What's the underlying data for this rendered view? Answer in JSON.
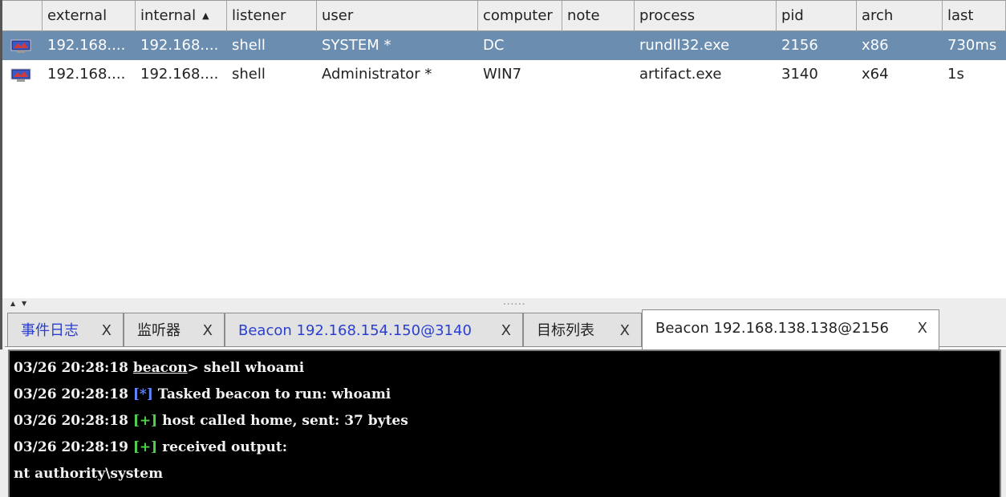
{
  "table": {
    "columns": [
      {
        "key": "external",
        "label": "external"
      },
      {
        "key": "internal",
        "label": "internal",
        "sort": "▲"
      },
      {
        "key": "listener",
        "label": "listener"
      },
      {
        "key": "user",
        "label": "user"
      },
      {
        "key": "computer",
        "label": "computer"
      },
      {
        "key": "note",
        "label": "note"
      },
      {
        "key": "process",
        "label": "process"
      },
      {
        "key": "pid",
        "label": "pid"
      },
      {
        "key": "arch",
        "label": "arch"
      },
      {
        "key": "last",
        "label": "last"
      }
    ],
    "rows": [
      {
        "external": "192.168....",
        "internal": "192.168....",
        "listener": "shell",
        "user": "SYSTEM *",
        "computer": "DC",
        "note": "",
        "process": "rundll32.exe",
        "pid": "2156",
        "arch": "x86",
        "last": "730ms",
        "icon": "beacon-session-icon",
        "selected": true
      },
      {
        "external": "192.168....",
        "internal": "192.168....",
        "listener": "shell",
        "user": "Administrator *",
        "computer": "WIN7",
        "note": "",
        "process": "artifact.exe",
        "pid": "3140",
        "arch": "x64",
        "last": "1s",
        "icon": "beacon-session-icon",
        "selected": false
      }
    ]
  },
  "tabs": [
    {
      "label": "事件日志",
      "close": "X",
      "style": "blue",
      "active": false
    },
    {
      "label": "监听器",
      "close": "X",
      "style": "normal",
      "active": false
    },
    {
      "label": "Beacon 192.168.154.150@3140",
      "close": "X",
      "style": "blue",
      "active": false
    },
    {
      "label": "目标列表",
      "close": "X",
      "style": "normal",
      "active": false
    },
    {
      "label": "Beacon 192.168.138.138@2156",
      "close": "X",
      "style": "normal",
      "active": true
    }
  ],
  "console": {
    "lines": [
      {
        "ts": "03/26 20:28:18",
        "prompt": "beacon",
        "prompt_suffix": ">",
        "text": " shell whoami"
      },
      {
        "ts": "03/26 20:28:18",
        "tag": "[*]",
        "tag_color": "blue",
        "text": " Tasked beacon to run: whoami"
      },
      {
        "ts": "03/26 20:28:18",
        "tag": "[+]",
        "tag_color": "green",
        "text": " host called home, sent: 37 bytes"
      },
      {
        "ts": "03/26 20:28:19",
        "tag": "[+]",
        "tag_color": "green",
        "text": " received output:"
      },
      {
        "ts": "",
        "text": "nt authority\\system"
      }
    ]
  },
  "colors": {
    "selected_row": "#6a8db0",
    "console_bg": "#000000",
    "tag_blue": "#5f86ff",
    "tag_green": "#4ed24e",
    "tab_blue_text": "#2a3fcf"
  },
  "icons": {
    "splitter_up": "▲",
    "splitter_down": "▼",
    "splitter_grip": "∙∙∙∙∙∙"
  }
}
